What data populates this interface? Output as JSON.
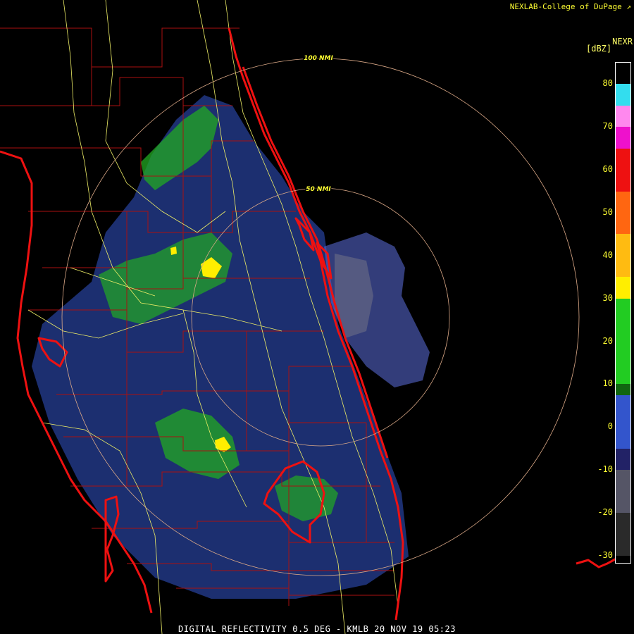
{
  "credit": "NEXLAB-College of DuPage",
  "legend": {
    "title": "NEXR",
    "unit": "[dBZ]",
    "ticks": [
      {
        "label": "80",
        "value": 80
      },
      {
        "label": "70",
        "value": 70
      },
      {
        "label": "60",
        "value": 60
      },
      {
        "label": "50",
        "value": 50
      },
      {
        "label": "40",
        "value": 40
      },
      {
        "label": "30",
        "value": 30
      },
      {
        "label": "20",
        "value": 20
      },
      {
        "label": "10",
        "value": 10
      },
      {
        "label": "0",
        "value": 0
      },
      {
        "label": "-10",
        "value": -10
      },
      {
        "label": "-20",
        "value": -20
      },
      {
        "label": "-30",
        "value": -30
      }
    ],
    "color_stops": [
      {
        "from": 85,
        "to": 80,
        "color": "#000000"
      },
      {
        "from": 80,
        "to": 75,
        "color": "#33ddee"
      },
      {
        "from": 75,
        "to": 70,
        "color": "#ff88ee"
      },
      {
        "from": 70,
        "to": 65,
        "color": "#ee11cc"
      },
      {
        "from": 65,
        "to": 55,
        "color": "#ee1111"
      },
      {
        "from": 55,
        "to": 45,
        "color": "#ff6611"
      },
      {
        "from": 45,
        "to": 35,
        "color": "#ffbb11"
      },
      {
        "from": 35,
        "to": 30,
        "color": "#ffee00"
      },
      {
        "from": 30,
        "to": 10,
        "color": "#22cc22"
      },
      {
        "from": 10,
        "to": 7.5,
        "color": "#116611"
      },
      {
        "from": 7.5,
        "to": -5,
        "color": "#3355cc"
      },
      {
        "from": -5,
        "to": -10,
        "color": "#222266"
      },
      {
        "from": -10,
        "to": -20,
        "color": "#555566"
      },
      {
        "from": -20,
        "to": -30,
        "color": "#2a2a2a"
      },
      {
        "from": -30,
        "to": -32,
        "color": "#000000"
      }
    ],
    "range": [
      -32,
      85
    ]
  },
  "range_rings": [
    {
      "label": "100 NMI"
    },
    {
      "label": "50 NMI"
    }
  ],
  "footer": "DIGITAL REFLECTIVITY 0.5 DEG - KMLB 20 NOV 19 05:23",
  "colors": {
    "coast": "#ee1111",
    "county": "#aa1111",
    "roads": "#eeee66",
    "rings": "#ddaa88"
  }
}
